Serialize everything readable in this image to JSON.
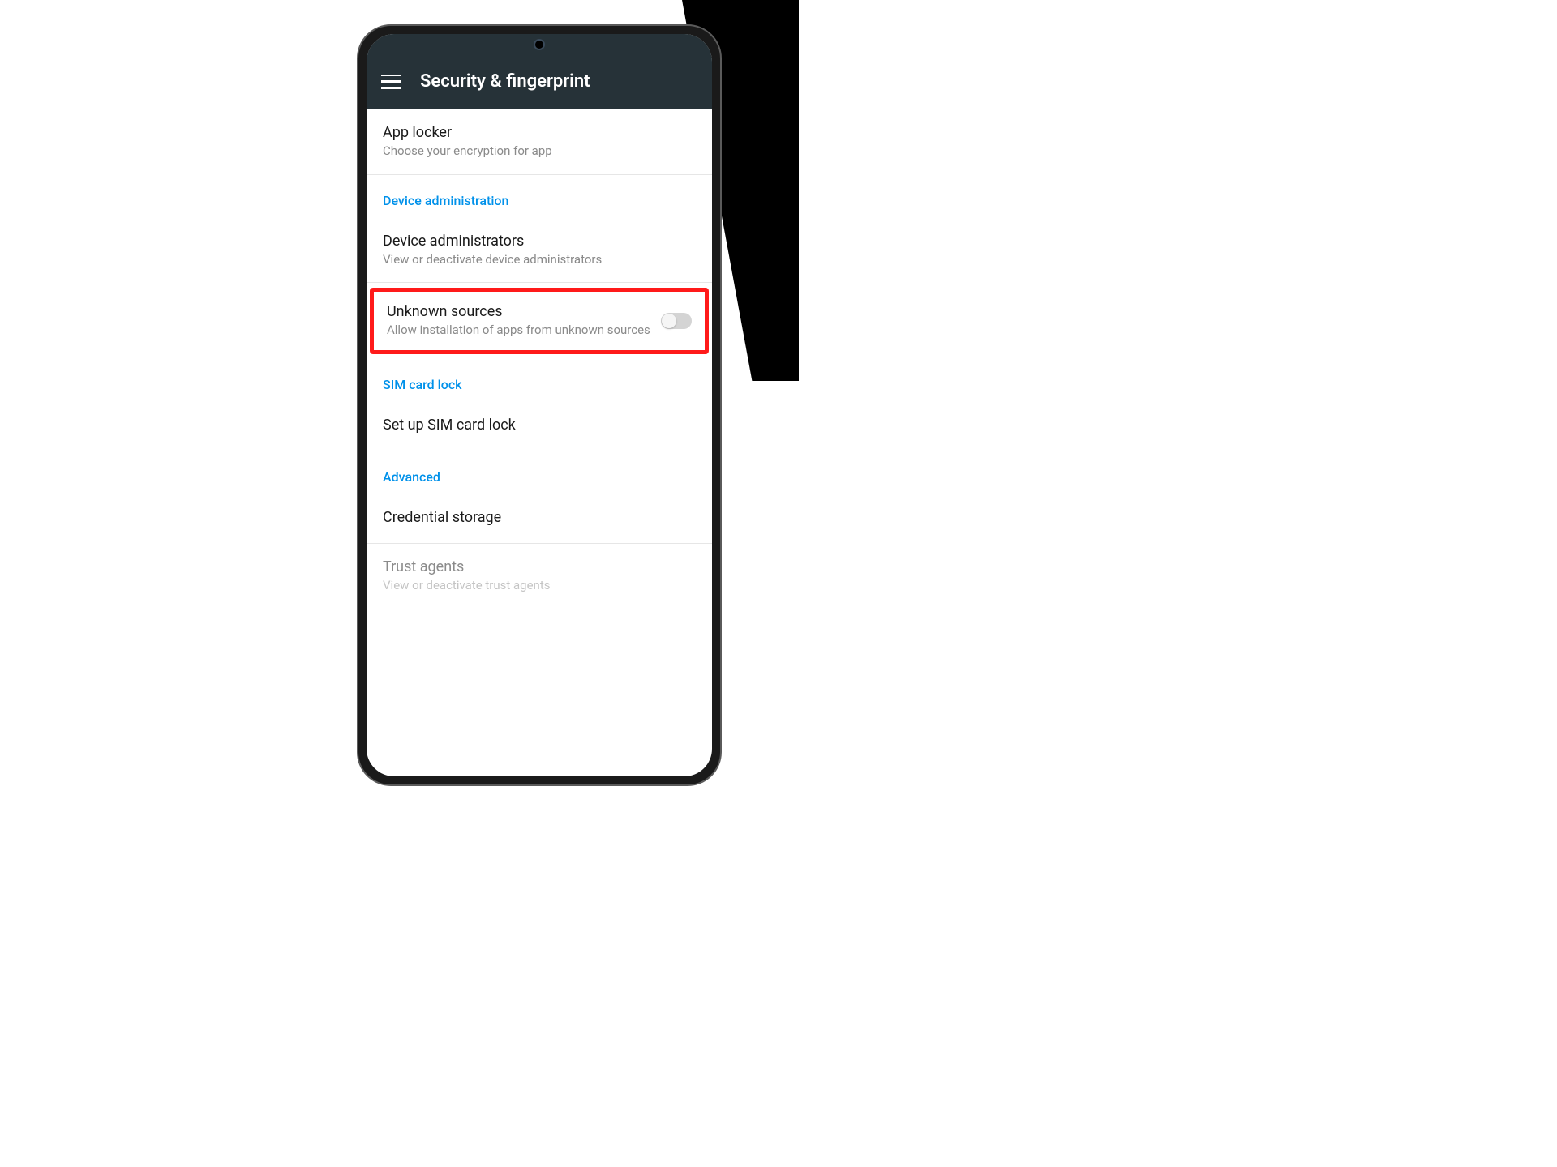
{
  "header": {
    "title": "Security & fingerprint"
  },
  "items": [
    {
      "title": "App locker",
      "subtitle": "Choose your encryption for app"
    }
  ],
  "section1": "Device administration",
  "deviceAdmin": {
    "title": "Device administrators",
    "subtitle": "View or deactivate device administrators"
  },
  "unknown": {
    "title": "Unknown sources",
    "subtitle": "Allow installation of apps from unknown sources"
  },
  "section2": "SIM card lock",
  "simLock": {
    "title": "Set up SIM card lock"
  },
  "section3": "Advanced",
  "credential": {
    "title": "Credential storage"
  },
  "trust": {
    "title": "Trust agents",
    "subtitle": "View or deactivate trust agents"
  }
}
